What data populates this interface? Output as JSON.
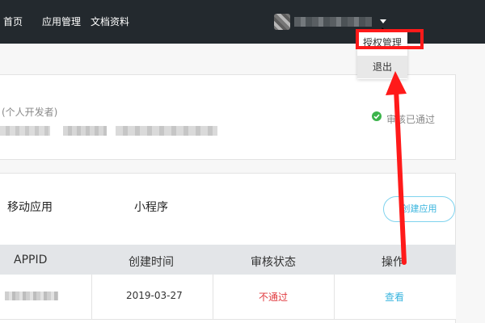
{
  "nav": {
    "home": "首页",
    "apps": "应用管理",
    "docs": "文档资料"
  },
  "user_menu": {
    "icon": "chevron-down-icon",
    "items": [
      "授权管理",
      "退出"
    ]
  },
  "developer": {
    "type": "(个人开发者)",
    "audit_status": "审核已通过",
    "status_icon": "check-circle-icon"
  },
  "apps": {
    "tabs": [
      "移动应用",
      "小程序"
    ],
    "create_button": "创建应用",
    "table": {
      "headers": [
        "APPID",
        "创建时间",
        "审核状态",
        "操作"
      ],
      "rows": [
        {
          "created": "2019-03-27",
          "status": "不通过",
          "action": "查看"
        }
      ]
    }
  },
  "colors": {
    "topbar": "#23292e",
    "accent": "#38b4de",
    "fail": "#e0393e",
    "pass": "#3cb44b",
    "annotation": "#ff1a1a"
  }
}
